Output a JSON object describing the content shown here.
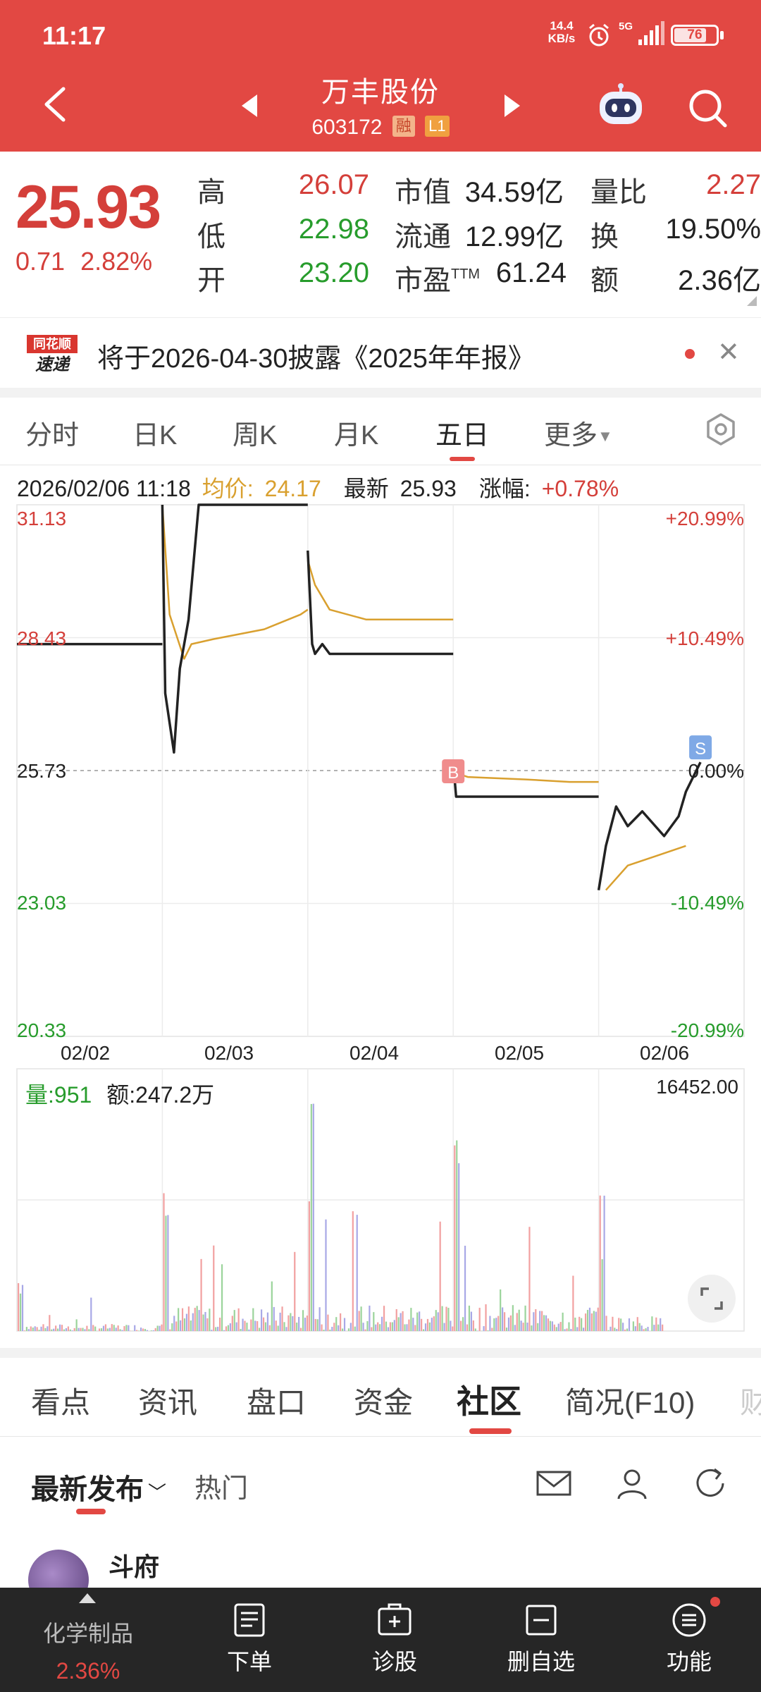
{
  "status_bar": {
    "time": "11:17",
    "net_speed_value": "14.4",
    "net_speed_unit": "KB/s",
    "network": "5G",
    "battery": "76"
  },
  "header": {
    "stock_name": "万丰股份",
    "stock_code": "603172",
    "tag_margin": "融",
    "tag_level": "L1"
  },
  "quote": {
    "price": "25.93",
    "change": "0.71",
    "change_pct": "2.82%",
    "high_label": "高",
    "high": "26.07",
    "low_label": "低",
    "low": "22.98",
    "open_label": "开",
    "open": "23.20",
    "mktcap_label": "市值",
    "mktcap": "34.59亿",
    "float_label": "流通",
    "float": "12.99亿",
    "pe_label": "市盈",
    "pe_sup": "TTM",
    "pe": "61.24",
    "vol_ratio_label": "量比",
    "vol_ratio": "2.27",
    "turnover_label": "换",
    "turnover": "19.50%",
    "amount_label": "额",
    "amount": "2.36亿"
  },
  "notice": {
    "logo_top": "同花顺",
    "logo_bottom": "速递",
    "text": "将于2026-04-30披露《2025年年报》"
  },
  "chart_tabs": [
    "分时",
    "日K",
    "周K",
    "月K",
    "五日",
    "更多"
  ],
  "chart_tabs_active": "五日",
  "info_line": {
    "datetime": "2026/02/06 11:18",
    "avg_label": "均价:",
    "avg": "24.17",
    "latest_label": "最新",
    "latest": "25.93",
    "chg_label": "涨幅:",
    "chg": "+0.78%"
  },
  "volume_legend": {
    "vol_label": "量:",
    "vol": "951",
    "amt_label": "额:",
    "amt": "247.2万",
    "max": "16452.00"
  },
  "chart_data": {
    "type": "line",
    "x": [
      "02/02",
      "02/03",
      "02/04",
      "02/05",
      "02/06"
    ],
    "yticks_left": [
      "31.13",
      "28.43",
      "25.73",
      "23.03",
      "20.33"
    ],
    "yticks_right": [
      "+20.99%",
      "+10.49%",
      "0.00%",
      "-10.49%",
      "-20.99%"
    ],
    "ylim": [
      20.33,
      31.13
    ],
    "prev_close": 25.73,
    "series": [
      {
        "name": "最新",
        "color": "#222222",
        "days": [
          [
            [
              0,
              28.3
            ],
            [
              1,
              28.3
            ]
          ],
          [
            [
              0,
              31.13
            ],
            [
              0.02,
              27.3
            ],
            [
              0.08,
              26.1
            ],
            [
              0.12,
              27.8
            ],
            [
              0.18,
              28.8
            ],
            [
              0.25,
              31.13
            ],
            [
              1,
              31.13
            ]
          ],
          [
            [
              0,
              30.2
            ],
            [
              0.03,
              28.3
            ],
            [
              0.05,
              28.1
            ],
            [
              0.1,
              28.3
            ],
            [
              0.15,
              28.1
            ],
            [
              1,
              28.1
            ]
          ],
          [
            [
              0,
              25.9
            ],
            [
              0.02,
              25.2
            ],
            [
              1,
              25.2
            ]
          ],
          [
            [
              0,
              23.3
            ],
            [
              0.05,
              24.2
            ],
            [
              0.12,
              25.0
            ],
            [
              0.2,
              24.6
            ],
            [
              0.3,
              24.9
            ],
            [
              0.45,
              24.4
            ],
            [
              0.55,
              24.8
            ],
            [
              0.6,
              25.3
            ],
            [
              0.7,
              25.9
            ]
          ]
        ]
      },
      {
        "name": "均价",
        "color": "#d9a02f",
        "days": [
          [
            [
              0,
              28.3
            ],
            [
              1,
              28.3
            ]
          ],
          [
            [
              0,
              31.13
            ],
            [
              0.05,
              28.9
            ],
            [
              0.15,
              28.0
            ],
            [
              0.2,
              28.3
            ],
            [
              0.35,
              28.4
            ],
            [
              0.7,
              28.6
            ],
            [
              0.95,
              28.9
            ],
            [
              1,
              29.0
            ]
          ],
          [
            [
              0,
              30.0
            ],
            [
              0.05,
              29.5
            ],
            [
              0.15,
              29.0
            ],
            [
              0.4,
              28.8
            ],
            [
              1,
              28.8
            ]
          ],
          [
            [
              0,
              25.7
            ],
            [
              0.1,
              25.6
            ],
            [
              0.5,
              25.55
            ],
            [
              0.8,
              25.5
            ],
            [
              1,
              25.5
            ]
          ],
          [
            [
              0.05,
              23.3
            ],
            [
              0.2,
              23.8
            ],
            [
              0.4,
              24.0
            ],
            [
              0.6,
              24.2
            ]
          ]
        ]
      }
    ],
    "markers": [
      {
        "label": "B",
        "color": "#f08c8c"
      },
      {
        "label": "S",
        "color": "#7fa9e6"
      }
    ]
  },
  "info_tabs": [
    "看点",
    "资讯",
    "盘口",
    "资金",
    "社区",
    "简况(F10)",
    "财"
  ],
  "info_tabs_active": "社区",
  "filters": {
    "latest": "最新发布",
    "hot": "热门"
  },
  "post": {
    "author": "斗府"
  },
  "bottom_nav": {
    "sector_name": "化学制品",
    "sector_pct": "2.36%",
    "items": [
      "下单",
      "诊股",
      "删自选",
      "功能"
    ]
  }
}
